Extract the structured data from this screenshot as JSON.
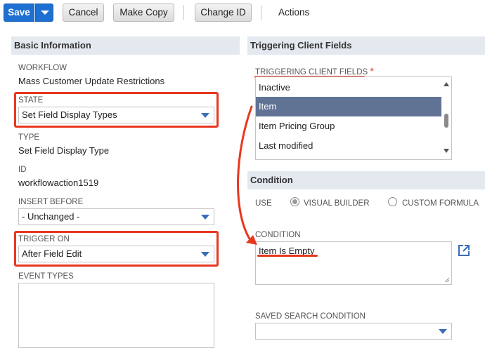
{
  "toolbar": {
    "save_label": "Save",
    "cancel_label": "Cancel",
    "make_copy_label": "Make Copy",
    "change_id_label": "Change ID",
    "actions_label": "Actions"
  },
  "basic_info": {
    "header": "Basic Information",
    "workflow_label": "WORKFLOW",
    "workflow_value": "Mass Customer Update Restrictions",
    "state_label": "STATE",
    "state_value": "Set Field Display Types",
    "type_label": "TYPE",
    "type_value": "Set Field Display Type",
    "id_label": "ID",
    "id_value": "workflowaction1519",
    "insert_before_label": "INSERT BEFORE",
    "insert_before_value": "- Unchanged -",
    "trigger_on_label": "TRIGGER ON",
    "trigger_on_value": "After Field Edit",
    "event_types_label": "EVENT TYPES"
  },
  "triggering": {
    "header": "Triggering Client Fields",
    "field_label": "TRIGGERING CLIENT FIELDS",
    "required_mark": "*",
    "options": [
      "Inactive",
      "Item",
      "Item Pricing Group",
      "Last modified"
    ],
    "selected_index": 1
  },
  "condition": {
    "header": "Condition",
    "use_label": "USE",
    "visual_builder_label": "VISUAL BUILDER",
    "custom_formula_label": "CUSTOM FORMULA",
    "selected_mode": "VISUAL BUILDER",
    "condition_label": "CONDITION",
    "condition_value": "Item Is Empty",
    "saved_search_label": "SAVED SEARCH CONDITION",
    "saved_search_value": ""
  },
  "colors": {
    "primary": "#1d6fd1",
    "highlight": "#e8371f",
    "selected_row": "#607395",
    "section_bg": "#e4e8ef"
  }
}
